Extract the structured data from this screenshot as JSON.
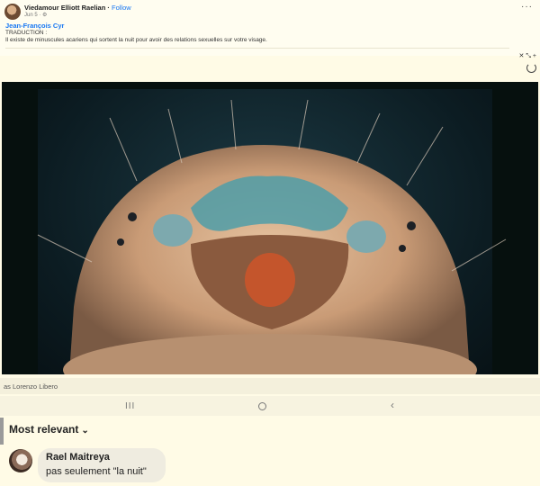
{
  "post": {
    "author": "Viedamour Elliott Raelian",
    "separator": " · ",
    "follow_label": "Follow",
    "date": "Jun 5 · ⚙",
    "more": "···",
    "tagged_name": "Jean-François Cyr",
    "label": "TRADUCTION :",
    "caption": "Il existe de minuscules acariens qui sortent la nuit pour avoir des relations sexuelles sur votre visage.",
    "toolbar": "✕ ⤡ +"
  },
  "photo": {
    "credit": "as Lorenzo Libero"
  },
  "navigation": {
    "recents": "III",
    "back": "‹"
  },
  "comments": {
    "sort_label": "Most relevant",
    "sort_chevron": "⌄",
    "items": [
      {
        "name": "Rael Maitreya",
        "text": "pas seulement \"la nuit\""
      }
    ]
  },
  "colors": {
    "background": "#fffbe6",
    "link": "#1877f2"
  }
}
